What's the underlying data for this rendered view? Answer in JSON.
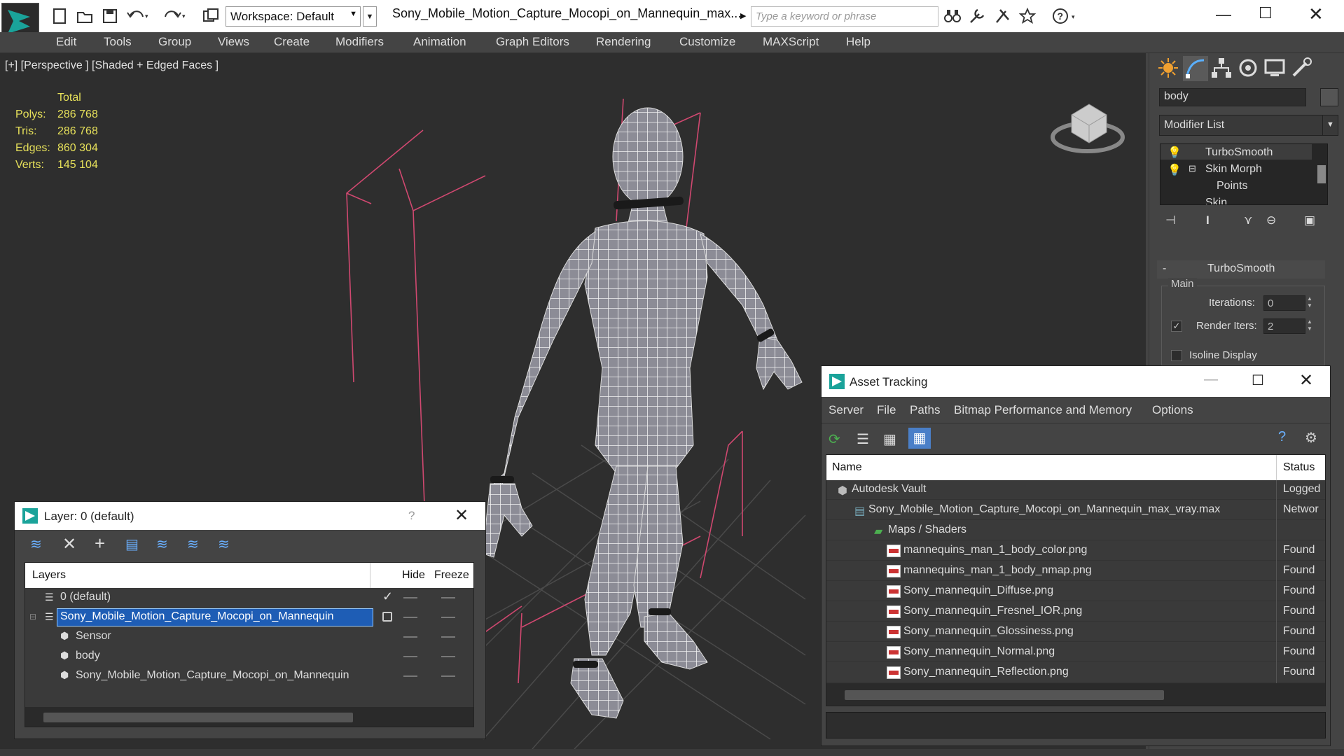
{
  "app": {
    "workspace_label": "Workspace: Default",
    "document_title": "Sony_Mobile_Motion_Capture_Mocopi_on_Mannequin_max...",
    "search_placeholder": "Type a keyword or phrase"
  },
  "menu": [
    "Edit",
    "Tools",
    "Group",
    "Views",
    "Create",
    "Modifiers",
    "Animation",
    "Graph Editors",
    "Rendering",
    "Customize",
    "MAXScript",
    "Help"
  ],
  "viewport": {
    "label": "[+] [Perspective ] [Shaded + Edged Faces ]",
    "stats_header": "Total",
    "stats": [
      {
        "label": "Polys:",
        "value": "286 768"
      },
      {
        "label": "Tris:",
        "value": "286 768"
      },
      {
        "label": "Edges:",
        "value": "860 304"
      },
      {
        "label": "Verts:",
        "value": "145 104"
      }
    ]
  },
  "command_panel": {
    "object_name": "body",
    "modifier_list": "Modifier List",
    "stack": [
      "TurboSmooth",
      "Skin Morph",
      "Points",
      "Skin"
    ],
    "rollout_title": "TurboSmooth",
    "group_main": "Main",
    "iterations_label": "Iterations:",
    "iterations_value": "0",
    "render_iters_label": "Render Iters:",
    "render_iters_value": "2",
    "render_iters_checked": true,
    "isoline_label": "Isoline Display"
  },
  "layer_window": {
    "title": "Layer: 0 (default)",
    "help": "?",
    "col_layers": "Layers",
    "col_hide": "Hide",
    "col_freeze": "Freeze",
    "rows": [
      {
        "name": "0 (default)",
        "level": 0,
        "type": "layer",
        "active": true,
        "selected": false
      },
      {
        "name": "Sony_Mobile_Motion_Capture_Mocopi_on_Mannequin",
        "level": 0,
        "type": "layer",
        "active": false,
        "selected": true
      },
      {
        "name": "Sensor",
        "level": 1,
        "type": "object",
        "active": false,
        "selected": false
      },
      {
        "name": "body",
        "level": 1,
        "type": "object",
        "active": false,
        "selected": false
      },
      {
        "name": "Sony_Mobile_Motion_Capture_Mocopi_on_Mannequin",
        "level": 1,
        "type": "object",
        "active": false,
        "selected": false
      }
    ]
  },
  "asset_window": {
    "title": "Asset Tracking",
    "menu": [
      "Server",
      "File",
      "Paths",
      "Bitmap Performance and Memory",
      "Options"
    ],
    "col_name": "Name",
    "col_status": "Status",
    "rows": [
      {
        "name": "Autodesk Vault",
        "status": "Logged",
        "level": 0,
        "icon": "vault"
      },
      {
        "name": "Sony_Mobile_Motion_Capture_Mocopi_on_Mannequin_max_vray.max",
        "status": "Networ",
        "level": 1,
        "icon": "max"
      },
      {
        "name": "Maps / Shaders",
        "status": "",
        "level": 2,
        "icon": "maps"
      },
      {
        "name": "mannequins_man_1_body_color.png",
        "status": "Found",
        "level": 3,
        "icon": "png"
      },
      {
        "name": "mannequins_man_1_body_nmap.png",
        "status": "Found",
        "level": 3,
        "icon": "png"
      },
      {
        "name": "Sony_mannequin_Diffuse.png",
        "status": "Found",
        "level": 3,
        "icon": "png"
      },
      {
        "name": "Sony_mannequin_Fresnel_IOR.png",
        "status": "Found",
        "level": 3,
        "icon": "png"
      },
      {
        "name": "Sony_mannequin_Glossiness.png",
        "status": "Found",
        "level": 3,
        "icon": "png"
      },
      {
        "name": "Sony_mannequin_Normal.png",
        "status": "Found",
        "level": 3,
        "icon": "png"
      },
      {
        "name": "Sony_mannequin_Reflection.png",
        "status": "Found",
        "level": 3,
        "icon": "png"
      }
    ]
  },
  "colors": {
    "accent": "#1e5db5",
    "stats": "#e6e05a",
    "bounding_box": "#d04870",
    "ui_dark": "#444444"
  }
}
